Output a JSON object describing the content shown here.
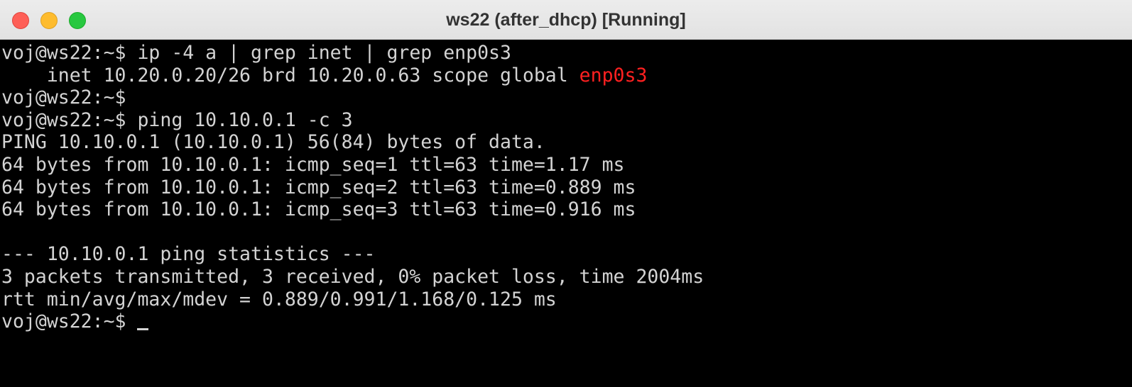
{
  "window": {
    "title": "ws22 (after_dhcp) [Running]",
    "accent_colors": {
      "close": "#fe5f57",
      "minimize": "#febc2e",
      "zoom": "#28c840",
      "highlight_text": "#ff2020"
    }
  },
  "terminal": {
    "lines": [
      "voj@ws22:~$ ip -4 a | grep inet | grep enp0s3",
      "    inet 10.20.0.20/26 brd 10.20.0.63 scope global ",
      "voj@ws22:~$",
      "voj@ws22:~$ ping 10.10.0.1 -c 3",
      "PING 10.10.0.1 (10.10.0.1) 56(84) bytes of data.",
      "64 bytes from 10.10.0.1: icmp_seq=1 ttl=63 time=1.17 ms",
      "64 bytes from 10.10.0.1: icmp_seq=2 ttl=63 time=0.889 ms",
      "64 bytes from 10.10.0.1: icmp_seq=3 ttl=63 time=0.916 ms",
      "",
      "--- 10.10.0.1 ping statistics ---",
      "3 packets transmitted, 3 received, 0% packet loss, time 2004ms",
      "rtt min/avg/max/mdev = 0.889/0.991/1.168/0.125 ms",
      "voj@ws22:~$ "
    ],
    "highlight_word": "enp0s3"
  }
}
